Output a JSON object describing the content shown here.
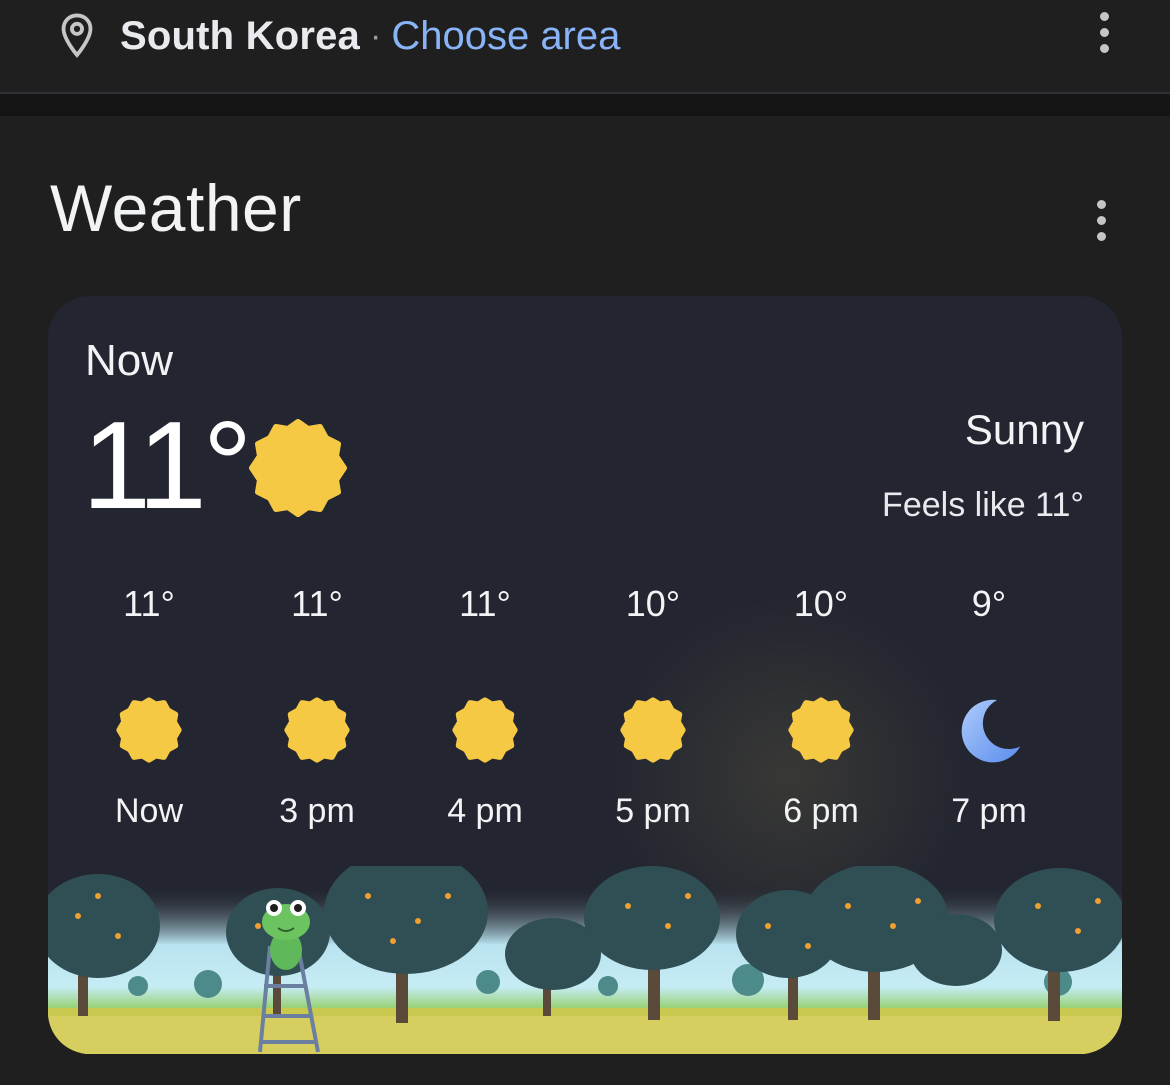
{
  "location": {
    "name": "South Korea",
    "separator": "·",
    "choose_area": "Choose area",
    "icon": "location-pin-icon"
  },
  "weather": {
    "section_title": "Weather",
    "now_label": "Now",
    "current_temp": "11°",
    "condition": "Sunny",
    "feels_like": "Feels like 11°",
    "current_icon": "sun-icon",
    "hourly": [
      {
        "temp": "11°",
        "time": "Now",
        "icon": "sun-icon"
      },
      {
        "temp": "11°",
        "time": "3 pm",
        "icon": "sun-icon"
      },
      {
        "temp": "11°",
        "time": "4 pm",
        "icon": "sun-icon"
      },
      {
        "temp": "10°",
        "time": "5 pm",
        "icon": "sun-icon"
      },
      {
        "temp": "10°",
        "time": "6 pm",
        "icon": "sun-icon"
      },
      {
        "temp": "9°",
        "time": "7 pm",
        "icon": "moon-icon"
      }
    ]
  },
  "colors": {
    "background": "#1f1f1f",
    "card": "#232630",
    "link": "#8ab4f8",
    "sun": "#f6c945",
    "moon": "#8ab4f8"
  }
}
